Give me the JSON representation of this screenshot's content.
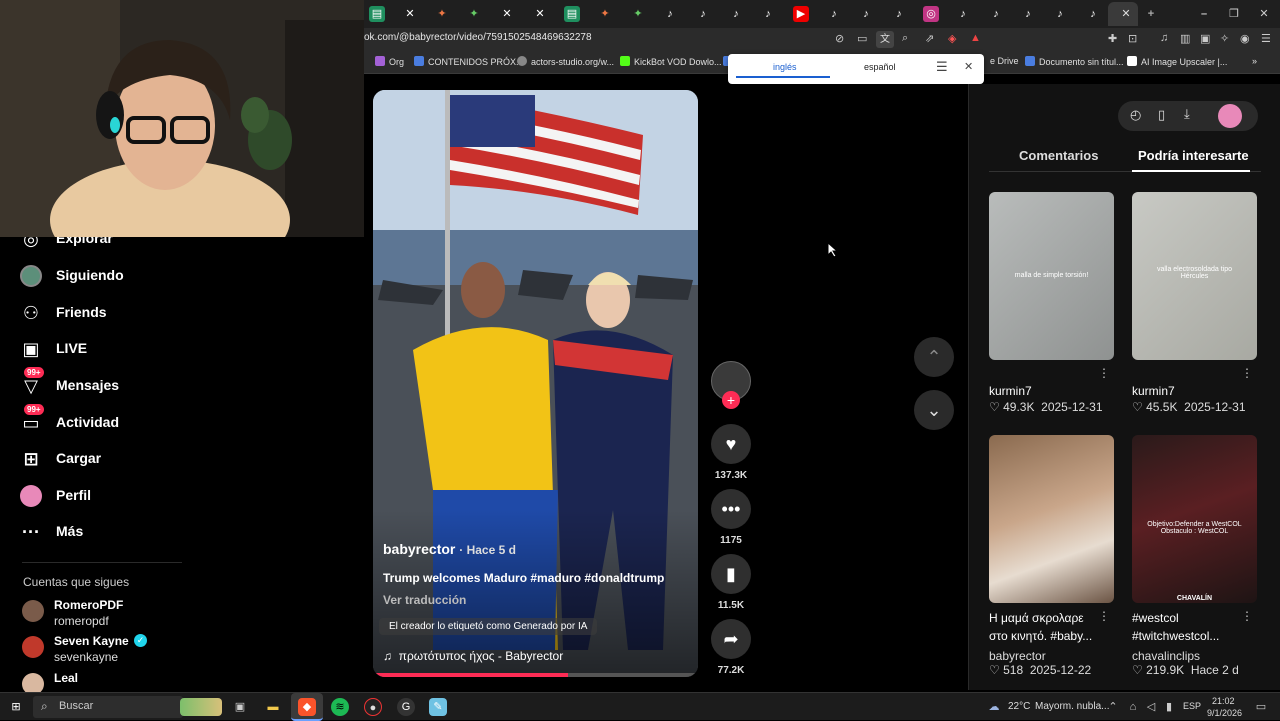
{
  "browser": {
    "url": "ok.com/@babyrector/video/7591502548469632278",
    "bookmarks": [
      "Org",
      "CONTENIDOS PRÓX...",
      "actors-studio.org/w...",
      "KickBot VOD Dowlo...",
      "e Drive",
      "Documento sin títul...",
      "AI Image Upscaler |..."
    ],
    "translate": {
      "from": "inglés",
      "to": "español"
    }
  },
  "sidebar": {
    "items": [
      {
        "label": "Explorar",
        "icon": "compass-icon"
      },
      {
        "label": "Siguiendo",
        "icon": "following-avatar-icon"
      },
      {
        "label": "Friends",
        "icon": "friends-icon"
      },
      {
        "label": "LIVE",
        "icon": "live-tv-icon"
      },
      {
        "label": "Mensajes",
        "icon": "messages-icon",
        "badge": "99+"
      },
      {
        "label": "Actividad",
        "icon": "activity-icon",
        "badge": "99+"
      },
      {
        "label": "Cargar",
        "icon": "upload-icon"
      },
      {
        "label": "Perfil",
        "icon": "profile-avatar-icon"
      },
      {
        "label": "Más",
        "icon": "more-icon"
      }
    ],
    "following_title": "Cuentas que sigues",
    "accounts": [
      {
        "name": "RomeroPDF",
        "handle": "romeropdf"
      },
      {
        "name": "Seven Kayne",
        "handle": "sevenkayne",
        "verified": true
      },
      {
        "name": "Leal",
        "handle": ""
      }
    ]
  },
  "video": {
    "author": "babyrector",
    "time": "· Hace 5 d",
    "caption": "Trump welcomes Maduro #maduro #donaldtrump",
    "translate_link": "Ver traducción",
    "ai_label": "El creador lo etiquetó como Generado por IA",
    "sound": "πρωτότυπος ήχος - Babyrector",
    "progress": 0.6
  },
  "actions": {
    "likes": "137.3K",
    "comments": "1175",
    "saves": "11.5K",
    "shares": "77.2K"
  },
  "panel": {
    "tabs": [
      "Comentarios",
      "Podría interesarte"
    ],
    "active_tab": 1,
    "cards": [
      {
        "overlay": "malla de simple torsión!",
        "caption": "",
        "author": "kurmin7",
        "likes": "49.3K",
        "date": "2025-12-31"
      },
      {
        "overlay": "valla electrosoldada tipo Hércules",
        "caption": "",
        "author": "kurmin7",
        "likes": "45.5K",
        "date": "2025-12-31"
      },
      {
        "overlay": "",
        "caption": "Η μαμά σκρολαρε στο κινητό. #baby...",
        "author": "babyrector",
        "likes": "518",
        "date": "2025-12-22"
      },
      {
        "overlay": "Objetivo:Defender a WestCOL Obstaculo : WestCOL",
        "overlay2": "CHAVALÍN",
        "caption": "#westcol #twitchwestcol...",
        "author": "chavalinclips",
        "likes": "219.9K",
        "date": "Hace 2 d"
      }
    ]
  },
  "taskbar": {
    "search": "Buscar",
    "weather": "22°C",
    "weather_text": "Mayorm. nubla...",
    "lang": "ESP",
    "time": "21:02",
    "date": "9/1/2026"
  },
  "colors": {
    "accent": "#fe2c55",
    "panel_bg": "#121212"
  }
}
